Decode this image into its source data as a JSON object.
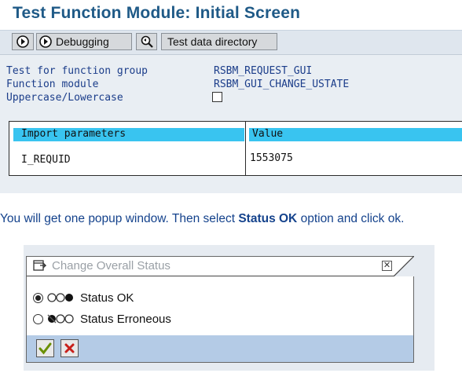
{
  "sap_screen": {
    "title": "Test Function Module: Initial Screen",
    "toolbar": {
      "debugging_label": "Debugging",
      "test_data_directory_label": "Test data directory"
    },
    "fields": [
      {
        "label": "Test for function group",
        "value": "RSBM_REQUEST_GUI"
      },
      {
        "label": "Function module",
        "value": "RSBM_GUI_CHANGE_USTATE"
      },
      {
        "label": "Uppercase/Lowercase",
        "value": ""
      }
    ],
    "table": {
      "headers": [
        "Import parameters",
        "Value"
      ],
      "rows": [
        {
          "param": "I_REQUID",
          "value": "1553075"
        }
      ]
    }
  },
  "instruction": {
    "before": "You will get one popup window. Then select ",
    "bold": "Status OK",
    "after": " option and click ok."
  },
  "popup": {
    "title": "Change Overall Status",
    "options": [
      {
        "label": "Status OK",
        "selected": true
      },
      {
        "label": "Status Erroneous",
        "selected": false
      }
    ],
    "icons": [
      "confirm-check-icon",
      "cancel-x-icon"
    ]
  }
}
